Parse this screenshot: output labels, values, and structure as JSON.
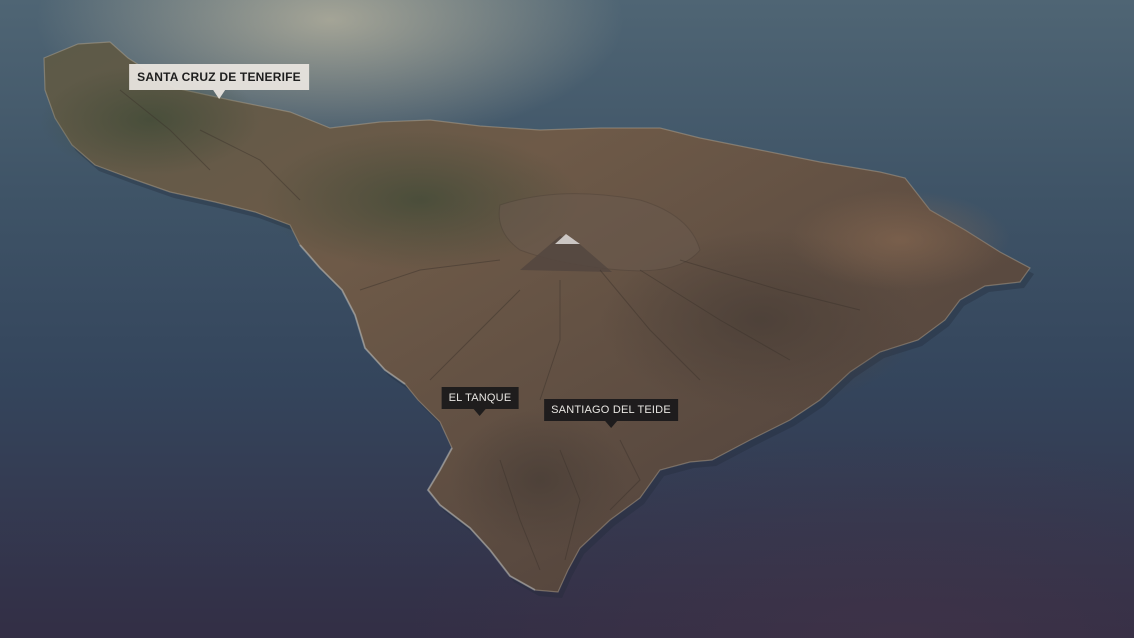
{
  "map": {
    "colors": {
      "sea_light": "#4f6574",
      "sea_dark": "#332e45",
      "land": "#6e5a48",
      "summit": "#d8d4d2"
    },
    "labels": {
      "santa_cruz": "SANTA CRUZ DE TENERIFE",
      "el_tanque": "EL TANQUE",
      "santiago_del_teide": "SANTIAGO DEL TEIDE"
    }
  }
}
